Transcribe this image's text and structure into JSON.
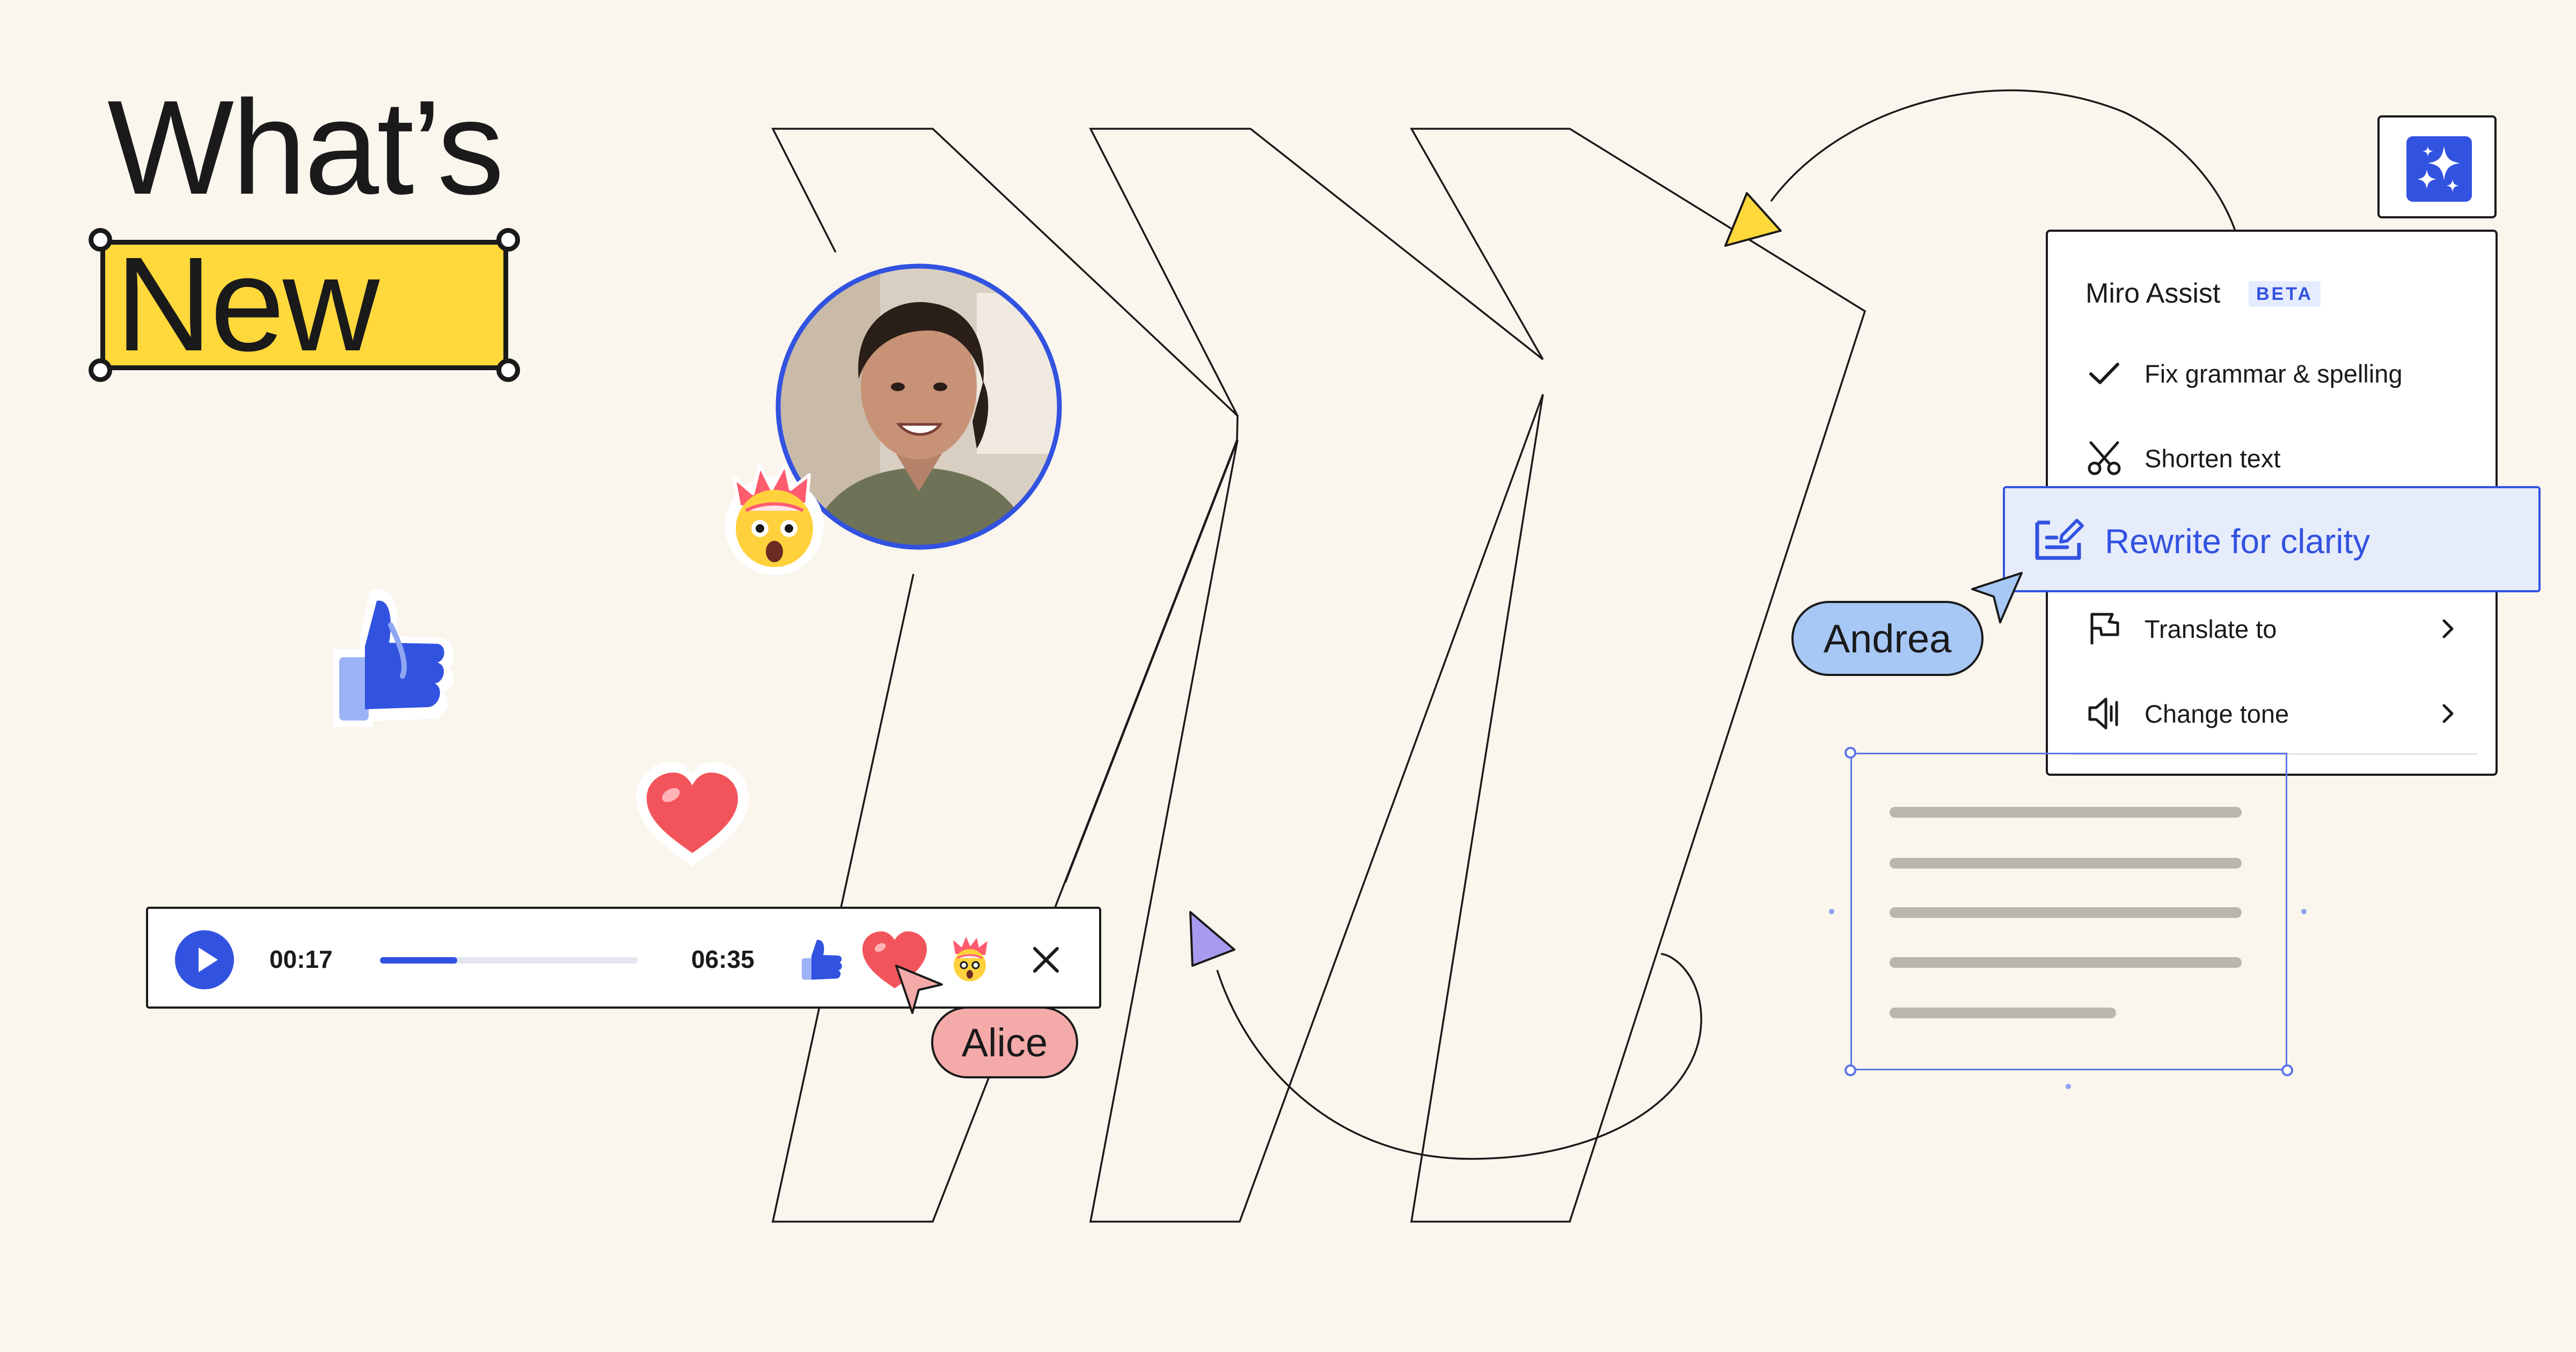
{
  "headline": {
    "line1": "What’s",
    "line2": "New"
  },
  "player": {
    "elapsed": "00:17",
    "duration": "06:35",
    "progress_fraction": 0.3,
    "accent_color": "#3252E0"
  },
  "reactions": [
    "thumbs-up-icon",
    "heart-icon",
    "mind-blown-icon"
  ],
  "cursors": {
    "alice": {
      "name": "Alice",
      "color": "#F5AAAA"
    },
    "andrea": {
      "name": "Andrea",
      "color": "#A7C7F5"
    }
  },
  "assist": {
    "title": "Miro Assist",
    "badge": "BETA",
    "items": [
      {
        "label": "Fix grammar & spelling",
        "icon": "check-icon"
      },
      {
        "label": "Shorten text",
        "icon": "scissors-icon"
      },
      {
        "label": "Rewrite for clarity",
        "icon": "rewrite-icon"
      },
      {
        "label": "Translate to",
        "icon": "flag-icon"
      },
      {
        "label": "Change tone",
        "icon": "speaker-icon"
      }
    ]
  },
  "colors": {
    "background": "#FAF6EE",
    "highlight_yellow": "#FFD83C",
    "primary_blue": "#3252E0",
    "heart_red": "#F2545B"
  }
}
